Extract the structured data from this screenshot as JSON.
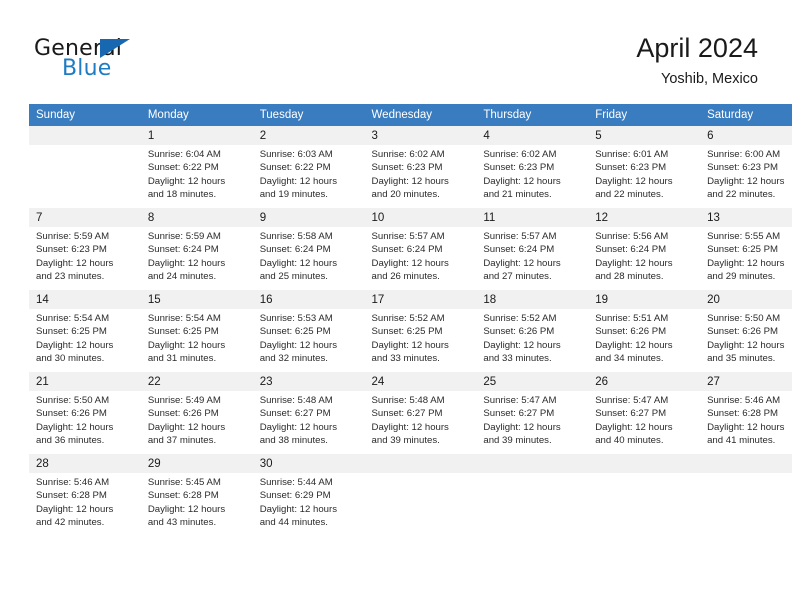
{
  "brand": {
    "name_part1": "General",
    "name_part2": "Blue",
    "flag_icon": "triangle-flag-icon",
    "accent_color": "#1f7cc2"
  },
  "header": {
    "title": "April 2024",
    "location": "Yoshib, Mexico"
  },
  "theme": {
    "header_row_bg": "#3a7cc0",
    "header_row_text": "#ffffff",
    "daynum_strip_bg": "#f1f1f1",
    "cell_bg": "#ffffff"
  },
  "weekdays": [
    "Sunday",
    "Monday",
    "Tuesday",
    "Wednesday",
    "Thursday",
    "Friday",
    "Saturday"
  ],
  "weeks": [
    [
      {
        "day": "",
        "sunrise": "",
        "sunset": "",
        "daylight_line1": "",
        "daylight_line2": ""
      },
      {
        "day": "1",
        "sunrise": "Sunrise: 6:04 AM",
        "sunset": "Sunset: 6:22 PM",
        "daylight_line1": "Daylight: 12 hours",
        "daylight_line2": "and 18 minutes."
      },
      {
        "day": "2",
        "sunrise": "Sunrise: 6:03 AM",
        "sunset": "Sunset: 6:22 PM",
        "daylight_line1": "Daylight: 12 hours",
        "daylight_line2": "and 19 minutes."
      },
      {
        "day": "3",
        "sunrise": "Sunrise: 6:02 AM",
        "sunset": "Sunset: 6:23 PM",
        "daylight_line1": "Daylight: 12 hours",
        "daylight_line2": "and 20 minutes."
      },
      {
        "day": "4",
        "sunrise": "Sunrise: 6:02 AM",
        "sunset": "Sunset: 6:23 PM",
        "daylight_line1": "Daylight: 12 hours",
        "daylight_line2": "and 21 minutes."
      },
      {
        "day": "5",
        "sunrise": "Sunrise: 6:01 AM",
        "sunset": "Sunset: 6:23 PM",
        "daylight_line1": "Daylight: 12 hours",
        "daylight_line2": "and 22 minutes."
      },
      {
        "day": "6",
        "sunrise": "Sunrise: 6:00 AM",
        "sunset": "Sunset: 6:23 PM",
        "daylight_line1": "Daylight: 12 hours",
        "daylight_line2": "and 22 minutes."
      }
    ],
    [
      {
        "day": "7",
        "sunrise": "Sunrise: 5:59 AM",
        "sunset": "Sunset: 6:23 PM",
        "daylight_line1": "Daylight: 12 hours",
        "daylight_line2": "and 23 minutes."
      },
      {
        "day": "8",
        "sunrise": "Sunrise: 5:59 AM",
        "sunset": "Sunset: 6:24 PM",
        "daylight_line1": "Daylight: 12 hours",
        "daylight_line2": "and 24 minutes."
      },
      {
        "day": "9",
        "sunrise": "Sunrise: 5:58 AM",
        "sunset": "Sunset: 6:24 PM",
        "daylight_line1": "Daylight: 12 hours",
        "daylight_line2": "and 25 minutes."
      },
      {
        "day": "10",
        "sunrise": "Sunrise: 5:57 AM",
        "sunset": "Sunset: 6:24 PM",
        "daylight_line1": "Daylight: 12 hours",
        "daylight_line2": "and 26 minutes."
      },
      {
        "day": "11",
        "sunrise": "Sunrise: 5:57 AM",
        "sunset": "Sunset: 6:24 PM",
        "daylight_line1": "Daylight: 12 hours",
        "daylight_line2": "and 27 minutes."
      },
      {
        "day": "12",
        "sunrise": "Sunrise: 5:56 AM",
        "sunset": "Sunset: 6:24 PM",
        "daylight_line1": "Daylight: 12 hours",
        "daylight_line2": "and 28 minutes."
      },
      {
        "day": "13",
        "sunrise": "Sunrise: 5:55 AM",
        "sunset": "Sunset: 6:25 PM",
        "daylight_line1": "Daylight: 12 hours",
        "daylight_line2": "and 29 minutes."
      }
    ],
    [
      {
        "day": "14",
        "sunrise": "Sunrise: 5:54 AM",
        "sunset": "Sunset: 6:25 PM",
        "daylight_line1": "Daylight: 12 hours",
        "daylight_line2": "and 30 minutes."
      },
      {
        "day": "15",
        "sunrise": "Sunrise: 5:54 AM",
        "sunset": "Sunset: 6:25 PM",
        "daylight_line1": "Daylight: 12 hours",
        "daylight_line2": "and 31 minutes."
      },
      {
        "day": "16",
        "sunrise": "Sunrise: 5:53 AM",
        "sunset": "Sunset: 6:25 PM",
        "daylight_line1": "Daylight: 12 hours",
        "daylight_line2": "and 32 minutes."
      },
      {
        "day": "17",
        "sunrise": "Sunrise: 5:52 AM",
        "sunset": "Sunset: 6:25 PM",
        "daylight_line1": "Daylight: 12 hours",
        "daylight_line2": "and 33 minutes."
      },
      {
        "day": "18",
        "sunrise": "Sunrise: 5:52 AM",
        "sunset": "Sunset: 6:26 PM",
        "daylight_line1": "Daylight: 12 hours",
        "daylight_line2": "and 33 minutes."
      },
      {
        "day": "19",
        "sunrise": "Sunrise: 5:51 AM",
        "sunset": "Sunset: 6:26 PM",
        "daylight_line1": "Daylight: 12 hours",
        "daylight_line2": "and 34 minutes."
      },
      {
        "day": "20",
        "sunrise": "Sunrise: 5:50 AM",
        "sunset": "Sunset: 6:26 PM",
        "daylight_line1": "Daylight: 12 hours",
        "daylight_line2": "and 35 minutes."
      }
    ],
    [
      {
        "day": "21",
        "sunrise": "Sunrise: 5:50 AM",
        "sunset": "Sunset: 6:26 PM",
        "daylight_line1": "Daylight: 12 hours",
        "daylight_line2": "and 36 minutes."
      },
      {
        "day": "22",
        "sunrise": "Sunrise: 5:49 AM",
        "sunset": "Sunset: 6:26 PM",
        "daylight_line1": "Daylight: 12 hours",
        "daylight_line2": "and 37 minutes."
      },
      {
        "day": "23",
        "sunrise": "Sunrise: 5:48 AM",
        "sunset": "Sunset: 6:27 PM",
        "daylight_line1": "Daylight: 12 hours",
        "daylight_line2": "and 38 minutes."
      },
      {
        "day": "24",
        "sunrise": "Sunrise: 5:48 AM",
        "sunset": "Sunset: 6:27 PM",
        "daylight_line1": "Daylight: 12 hours",
        "daylight_line2": "and 39 minutes."
      },
      {
        "day": "25",
        "sunrise": "Sunrise: 5:47 AM",
        "sunset": "Sunset: 6:27 PM",
        "daylight_line1": "Daylight: 12 hours",
        "daylight_line2": "and 39 minutes."
      },
      {
        "day": "26",
        "sunrise": "Sunrise: 5:47 AM",
        "sunset": "Sunset: 6:27 PM",
        "daylight_line1": "Daylight: 12 hours",
        "daylight_line2": "and 40 minutes."
      },
      {
        "day": "27",
        "sunrise": "Sunrise: 5:46 AM",
        "sunset": "Sunset: 6:28 PM",
        "daylight_line1": "Daylight: 12 hours",
        "daylight_line2": "and 41 minutes."
      }
    ],
    [
      {
        "day": "28",
        "sunrise": "Sunrise: 5:46 AM",
        "sunset": "Sunset: 6:28 PM",
        "daylight_line1": "Daylight: 12 hours",
        "daylight_line2": "and 42 minutes."
      },
      {
        "day": "29",
        "sunrise": "Sunrise: 5:45 AM",
        "sunset": "Sunset: 6:28 PM",
        "daylight_line1": "Daylight: 12 hours",
        "daylight_line2": "and 43 minutes."
      },
      {
        "day": "30",
        "sunrise": "Sunrise: 5:44 AM",
        "sunset": "Sunset: 6:29 PM",
        "daylight_line1": "Daylight: 12 hours",
        "daylight_line2": "and 44 minutes."
      },
      {
        "day": "",
        "sunrise": "",
        "sunset": "",
        "daylight_line1": "",
        "daylight_line2": ""
      },
      {
        "day": "",
        "sunrise": "",
        "sunset": "",
        "daylight_line1": "",
        "daylight_line2": ""
      },
      {
        "day": "",
        "sunrise": "",
        "sunset": "",
        "daylight_line1": "",
        "daylight_line2": ""
      },
      {
        "day": "",
        "sunrise": "",
        "sunset": "",
        "daylight_line1": "",
        "daylight_line2": ""
      }
    ]
  ]
}
